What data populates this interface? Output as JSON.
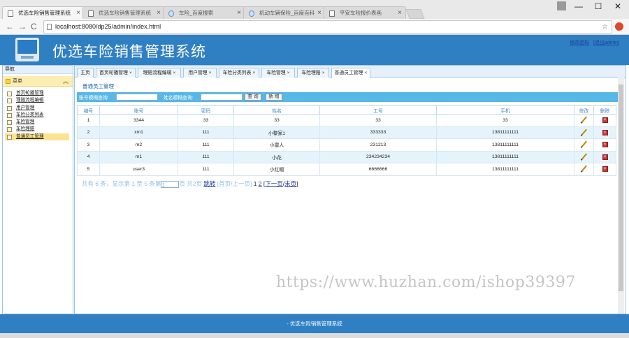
{
  "browser": {
    "tabs": [
      {
        "title": "优选车险销售管理系统",
        "active": true
      },
      {
        "title": "优选车险销售管理系统",
        "active": false
      },
      {
        "title": "车险_百度搜索",
        "active": false
      },
      {
        "title": "机动车辆保险_百度百科",
        "active": false
      },
      {
        "title": "平安车险报价表画",
        "active": false
      }
    ],
    "url": "localhost:8080/dp25/admin/index.html",
    "window_controls": [
      "—",
      "☐",
      "✕"
    ]
  },
  "header": {
    "title": "优选车险销售管理系统",
    "links": [
      "修改密码",
      "[退出admin]"
    ]
  },
  "sidebar": {
    "title": "导航",
    "group_label": "菜单",
    "items": [
      {
        "label": "首页轮播管理",
        "selected": false
      },
      {
        "label": "理赔流程编辑",
        "selected": false
      },
      {
        "label": "用户管理",
        "selected": false
      },
      {
        "label": "车险分类列表",
        "selected": false
      },
      {
        "label": "车险管理",
        "selected": false
      },
      {
        "label": "车险理赔",
        "selected": false
      },
      {
        "label": "普通员工管理",
        "selected": true
      }
    ]
  },
  "page_tabs": [
    {
      "label": "主页",
      "closable": false,
      "active": false
    },
    {
      "label": "首页轮播管理",
      "closable": true,
      "active": false
    },
    {
      "label": "理赔流程编辑",
      "closable": true,
      "active": false
    },
    {
      "label": "用户管理",
      "closable": true,
      "active": false
    },
    {
      "label": "车险分类列表",
      "closable": true,
      "active": false
    },
    {
      "label": "车险管理",
      "closable": true,
      "active": false
    },
    {
      "label": "车险理赔",
      "closable": true,
      "active": false
    },
    {
      "label": "普通员工管理",
      "closable": true,
      "active": true
    }
  ],
  "main": {
    "section_title": "普通员工管理",
    "search": {
      "account_label": "账号模糊查询:",
      "account_value": "",
      "name_label": "姓名模糊查询:",
      "name_value": "",
      "query_button": "查 询",
      "add_button": "新 增"
    },
    "table": {
      "columns": [
        "编号",
        "账号",
        "密码",
        "姓名",
        "工号",
        "手机",
        "修改",
        "删除"
      ],
      "rows": [
        [
          "1",
          "3344",
          "33",
          "33",
          "33",
          "33"
        ],
        [
          "2",
          "xm1",
          "111",
          "小黎家1",
          "333333",
          "13811111111"
        ],
        [
          "3",
          "m2",
          "111",
          "小雷人",
          "231213",
          "13811111111"
        ],
        [
          "4",
          "m1",
          "111",
          "小花",
          "234234234",
          "13811111111"
        ],
        [
          "5",
          "user3",
          "111",
          "小红帽",
          "6666666",
          "13811111111"
        ]
      ],
      "edit_icon": "pencil-icon",
      "delete_icon": "delete-icon"
    },
    "pager": {
      "summary": "共有 6 条，显示第 1 至 5 条第",
      "page_input": "1",
      "pages_text": "页 共2页",
      "jump": "跳转",
      "first_prev": "[首页/上一页]",
      "page1": "1",
      "page2": "2",
      "next_last_open": "[",
      "next": "下一页",
      "slash": "/",
      "last": "末页",
      "close": "]"
    }
  },
  "watermark": "https://www.huzhan.com/ishop39397",
  "footer": {
    "text": "- 优选车险销售管理系统"
  },
  "colors": {
    "header_blue": "#2f7fc3",
    "search_bar": "#57b7e6",
    "row_alt": "#e5f4fc",
    "menu_group": "#fcedb1"
  }
}
